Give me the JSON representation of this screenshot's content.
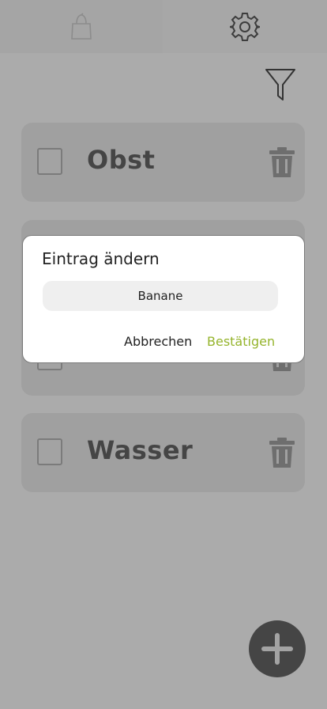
{
  "header": {
    "tabs": [
      {
        "icon": "shopping-bag-icon"
      },
      {
        "icon": "gear-icon"
      }
    ]
  },
  "toolbar": {
    "filter_icon": "filter-funnel-icon"
  },
  "list": {
    "items": [
      {
        "label": "Obst",
        "checked": false
      },
      {
        "label": "",
        "checked": false
      },
      {
        "label": "Wasser",
        "checked": false
      }
    ]
  },
  "fab": {
    "icon": "plus-icon"
  },
  "dialog": {
    "title": "Eintrag ändern",
    "input_value": "Banane",
    "cancel_label": "Abbrechen",
    "confirm_label": "Bestätigen"
  },
  "colors": {
    "overlay_background": "#ababab",
    "accent": "#95b42c",
    "dark": "#454545"
  }
}
